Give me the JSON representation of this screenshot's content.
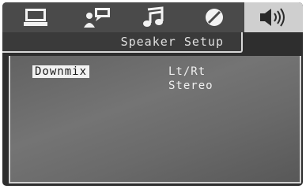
{
  "tabs": [
    {
      "id": "general",
      "icon": "monitor-icon"
    },
    {
      "id": "language",
      "icon": "person-speech-icon"
    },
    {
      "id": "audio",
      "icon": "music-note-icon"
    },
    {
      "id": "video",
      "icon": "circle-slash-icon"
    },
    {
      "id": "speaker",
      "icon": "speaker-icon",
      "active": true
    }
  ],
  "section_title": "Speaker Setup",
  "settings": [
    {
      "label": "Downmix",
      "selected": true,
      "options": [
        "Lt/Rt",
        "Stereo"
      ]
    }
  ],
  "colors": {
    "tabbar": "#4a4a4a",
    "active_tab": "#cfcfcf",
    "highlight": "#f2f2f2"
  }
}
